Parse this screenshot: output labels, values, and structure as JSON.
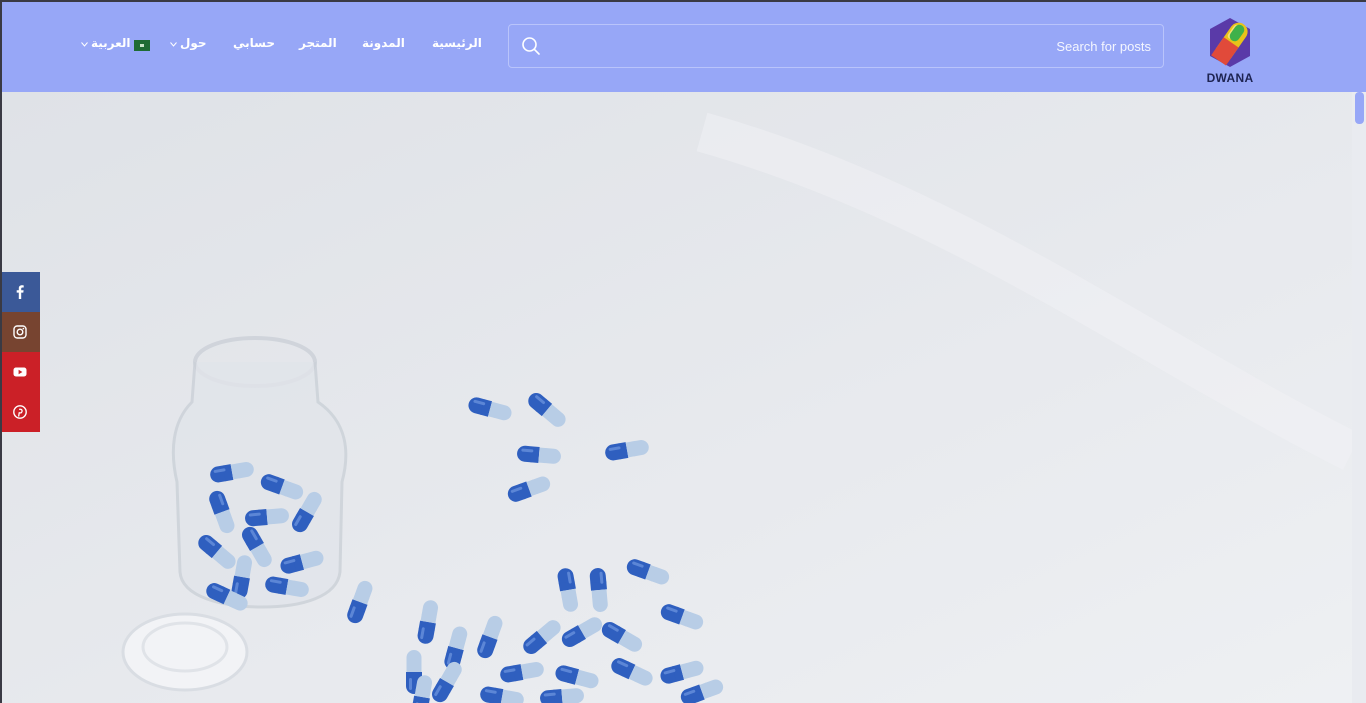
{
  "header": {
    "logo_text": "DWANA",
    "search": {
      "placeholder": "Search for posts"
    },
    "nav": {
      "home": "الرئيسية",
      "blog": "المدونة",
      "store": "المتجر",
      "account": "حسابي",
      "about": "حول",
      "language": "العربية"
    }
  },
  "social": {
    "items": [
      "facebook-icon",
      "instagram-icon",
      "youtube-icon",
      "pinterest-icon"
    ]
  },
  "colors": {
    "header_bg": "#97a7f7",
    "facebook": "#3b5998",
    "instagram": "#774430",
    "youtube": "#cb2027",
    "pinterest": "#cb2027",
    "capsule_blue": "#2f5fbf"
  }
}
